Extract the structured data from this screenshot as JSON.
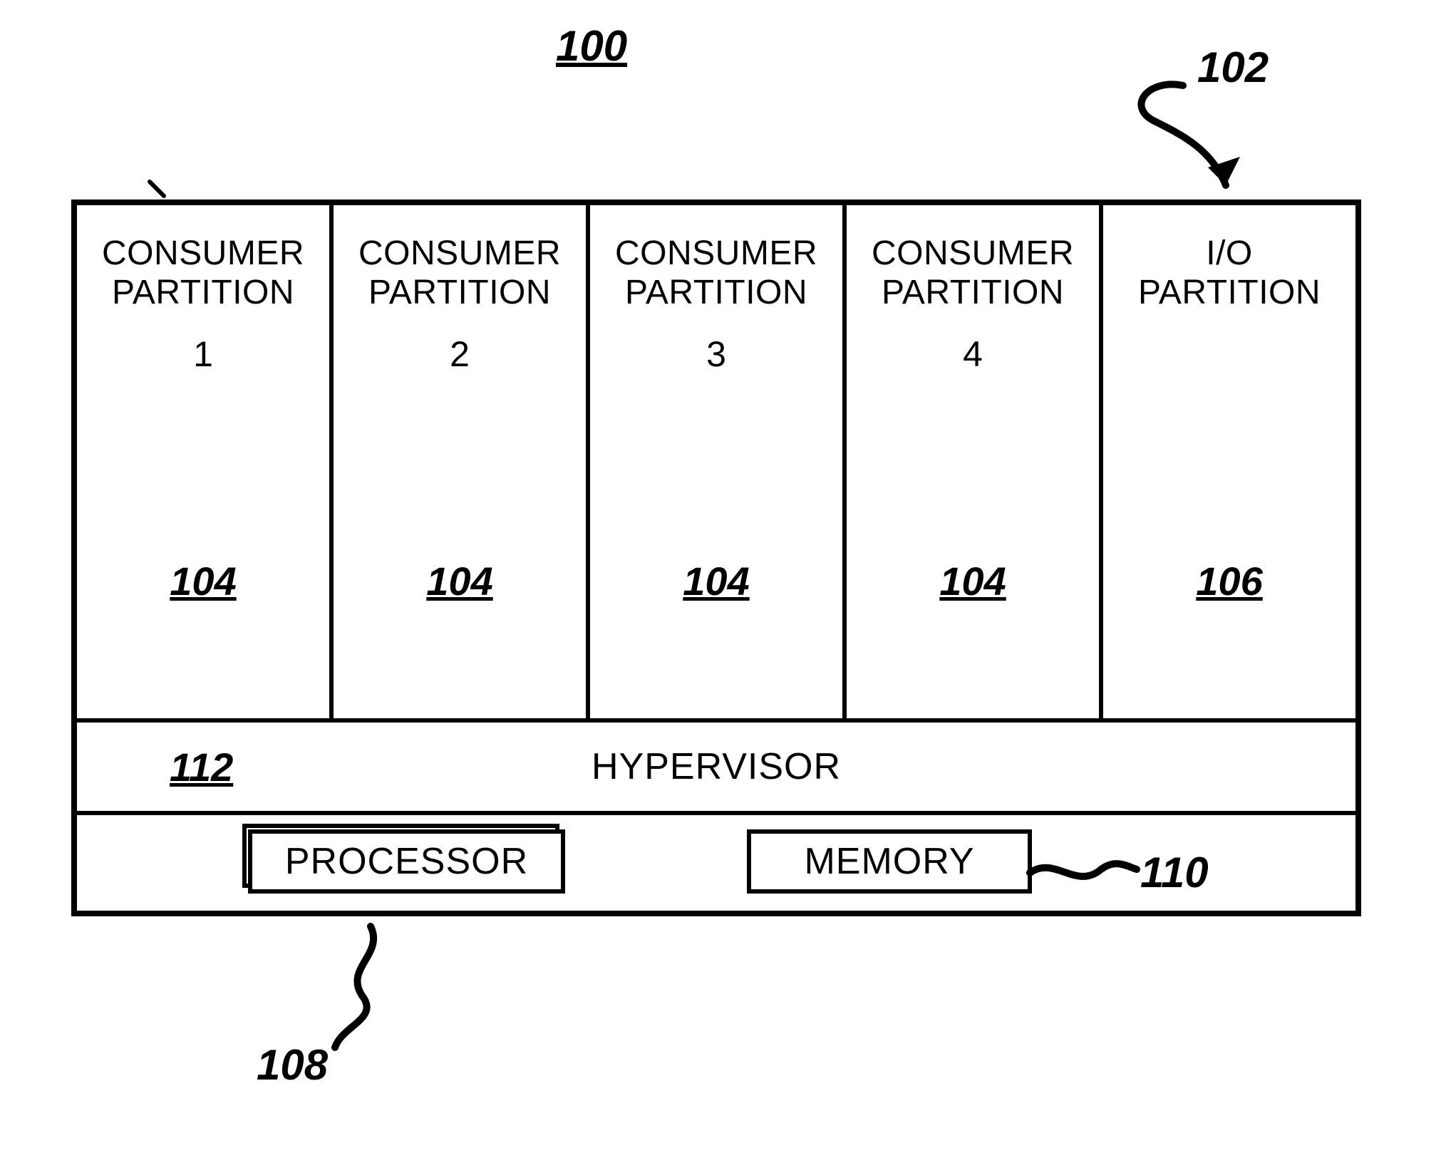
{
  "figure_number": "100",
  "callouts": {
    "c102": "102",
    "c110": "110",
    "c108": "108"
  },
  "partitions": [
    {
      "title_line1": "CONSUMER",
      "title_line2": "PARTITION",
      "num": "1",
      "ref": "104"
    },
    {
      "title_line1": "CONSUMER",
      "title_line2": "PARTITION",
      "num": "2",
      "ref": "104"
    },
    {
      "title_line1": "CONSUMER",
      "title_line2": "PARTITION",
      "num": "3",
      "ref": "104"
    },
    {
      "title_line1": "CONSUMER",
      "title_line2": "PARTITION",
      "num": "4",
      "ref": "104"
    },
    {
      "title_line1": "I/O",
      "title_line2": "PARTITION",
      "num": "",
      "ref": "106"
    }
  ],
  "hypervisor": {
    "label": "HYPERVISOR",
    "ref": "112"
  },
  "hardware": {
    "processor": "PROCESSOR",
    "memory": "MEMORY"
  }
}
